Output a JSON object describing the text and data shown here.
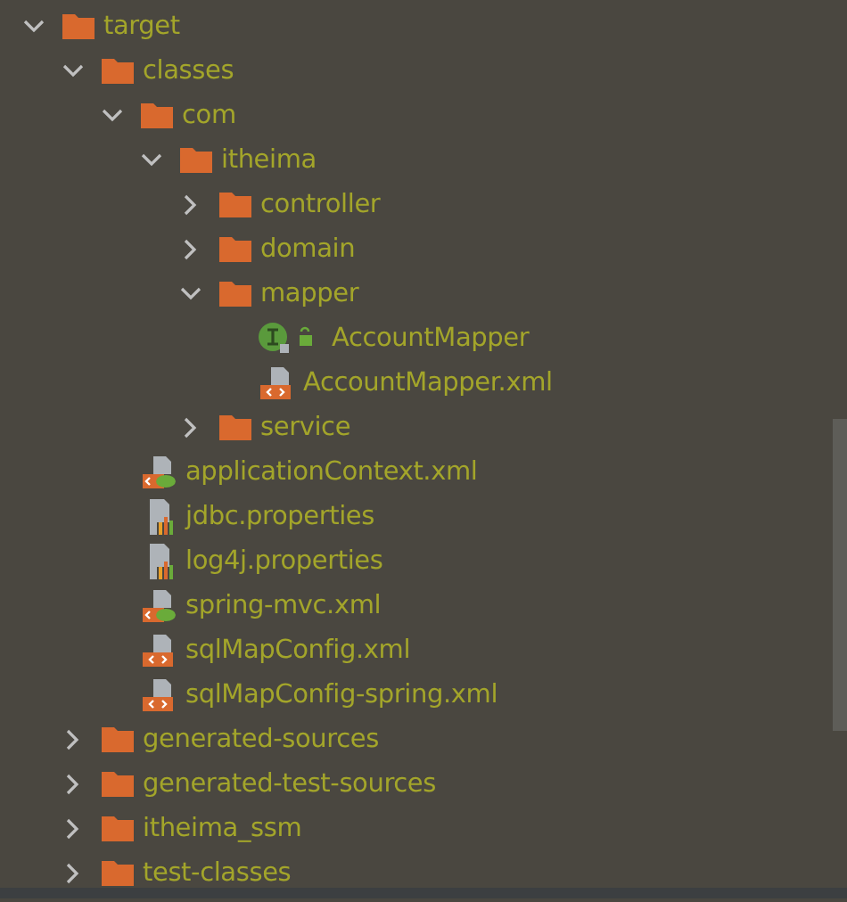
{
  "tree": [
    {
      "label": "target",
      "kind": "folder",
      "expanded": true,
      "children": [
        {
          "label": "classes",
          "kind": "folder",
          "expanded": true,
          "children": [
            {
              "label": "com",
              "kind": "folder",
              "expanded": true,
              "children": [
                {
                  "label": "itheima",
                  "kind": "folder",
                  "expanded": true,
                  "children": [
                    {
                      "label": "controller",
                      "kind": "folder",
                      "expanded": false
                    },
                    {
                      "label": "domain",
                      "kind": "folder",
                      "expanded": false
                    },
                    {
                      "label": "mapper",
                      "kind": "folder",
                      "expanded": true,
                      "children": [
                        {
                          "label": "AccountMapper",
                          "kind": "interface"
                        },
                        {
                          "label": "AccountMapper.xml",
                          "kind": "xml"
                        }
                      ]
                    },
                    {
                      "label": "service",
                      "kind": "folder",
                      "expanded": false
                    }
                  ]
                }
              ]
            },
            {
              "label": "applicationContext.xml",
              "kind": "spring-xml"
            },
            {
              "label": "jdbc.properties",
              "kind": "properties"
            },
            {
              "label": "log4j.properties",
              "kind": "properties"
            },
            {
              "label": "spring-mvc.xml",
              "kind": "spring-xml"
            },
            {
              "label": "sqlMapConfig.xml",
              "kind": "xml"
            },
            {
              "label": "sqlMapConfig-spring.xml",
              "kind": "xml"
            }
          ]
        },
        {
          "label": "generated-sources",
          "kind": "folder",
          "expanded": false
        },
        {
          "label": "generated-test-sources",
          "kind": "folder",
          "expanded": false
        },
        {
          "label": "itheima_ssm",
          "kind": "folder",
          "expanded": false
        },
        {
          "label": "test-classes",
          "kind": "folder",
          "expanded": false
        }
      ]
    }
  ]
}
